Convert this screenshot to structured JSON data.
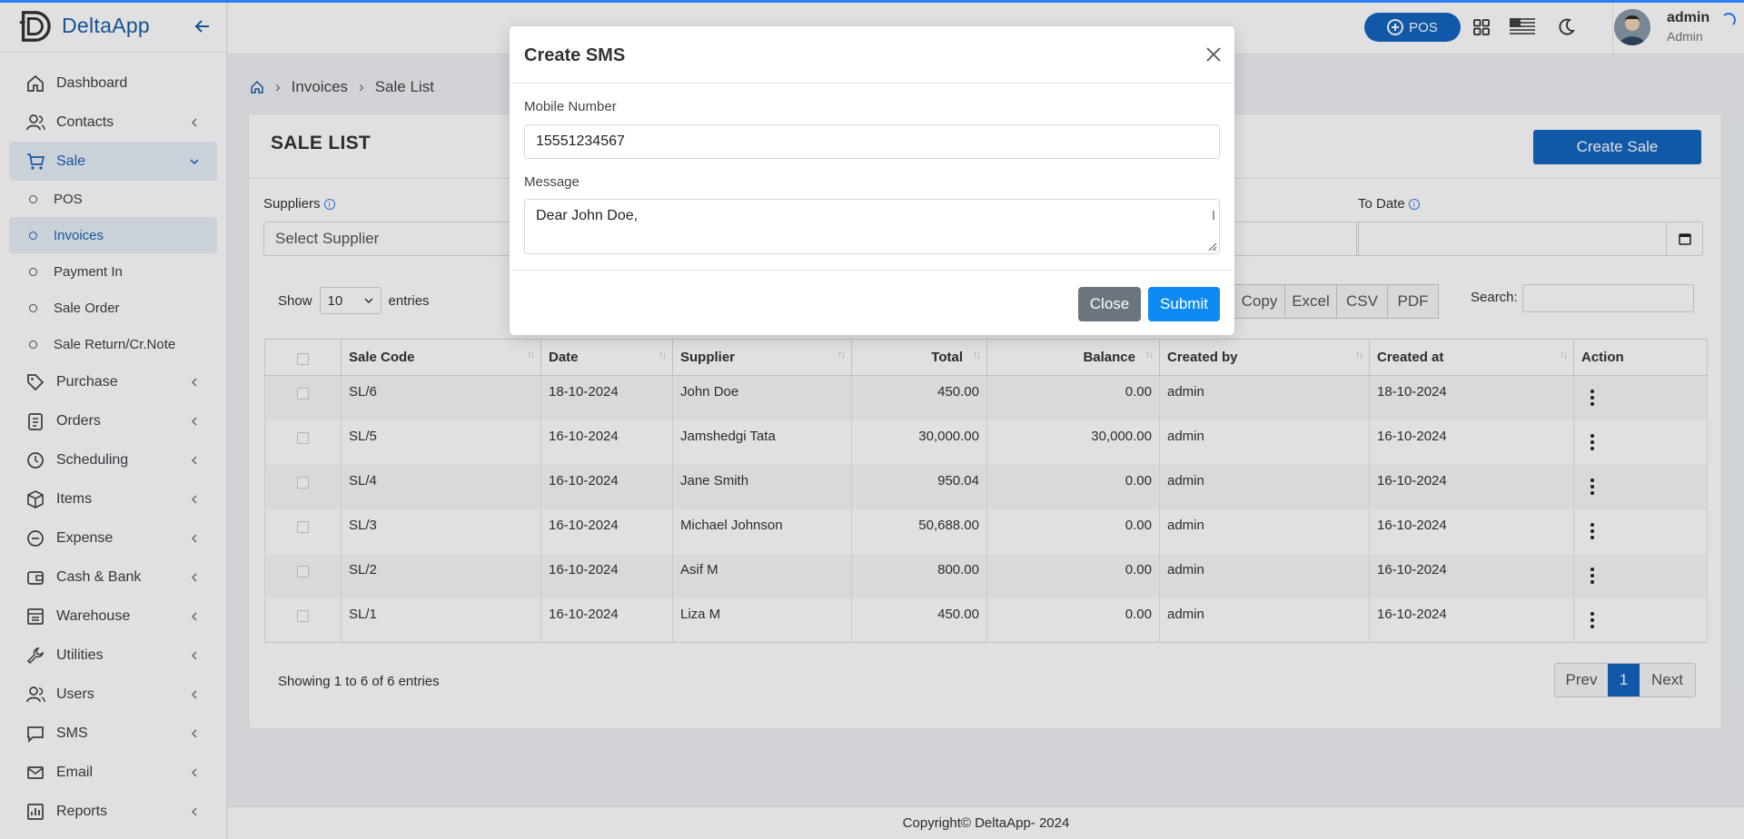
{
  "app": {
    "name": "DeltaApp"
  },
  "sidebar": {
    "items": [
      {
        "label": "Dashboard",
        "icon": "home-icon"
      },
      {
        "label": "Contacts",
        "icon": "users-icon"
      },
      {
        "label": "Sale",
        "icon": "cart-icon"
      },
      {
        "label": "Purchase",
        "icon": "tag-icon"
      },
      {
        "label": "Orders",
        "icon": "clipboard-icon"
      },
      {
        "label": "Scheduling",
        "icon": "calendar-clock-icon"
      },
      {
        "label": "Items",
        "icon": "box-icon"
      },
      {
        "label": "Expense",
        "icon": "minus-circle-icon"
      },
      {
        "label": "Cash & Bank",
        "icon": "wallet-icon"
      },
      {
        "label": "Warehouse",
        "icon": "warehouse-icon"
      },
      {
        "label": "Utilities",
        "icon": "wrench-icon"
      },
      {
        "label": "Users",
        "icon": "users-icon"
      },
      {
        "label": "SMS",
        "icon": "chat-icon"
      },
      {
        "label": "Email",
        "icon": "mail-icon"
      },
      {
        "label": "Reports",
        "icon": "chart-icon"
      }
    ],
    "sale_sub": [
      "POS",
      "Invoices",
      "Payment In",
      "Sale Order",
      "Sale Return/Cr.Note"
    ]
  },
  "topbar": {
    "pos_label": "POS",
    "user_name": "admin",
    "user_role": "Admin"
  },
  "breadcrumb": {
    "level1": "Invoices",
    "level2": "Sale List"
  },
  "page": {
    "title": "SALE LIST",
    "create_button": "Create Sale",
    "suppliers_label": "Suppliers",
    "supplier_placeholder": "Select Supplier",
    "to_date_label": "To Date",
    "show_label": "Show",
    "entries_value": "10",
    "entries_label": "entries",
    "export": [
      "Copy",
      "Excel",
      "CSV",
      "PDF"
    ],
    "search_label": "Search:"
  },
  "table": {
    "headers": [
      "Sale Code",
      "Date",
      "Supplier",
      "Total",
      "Balance",
      "Created by",
      "Created at",
      "Action"
    ],
    "rows": [
      [
        "SL/6",
        "18-10-2024",
        "John Doe",
        "450.00",
        "0.00",
        "admin",
        "18-10-2024"
      ],
      [
        "SL/5",
        "16-10-2024",
        "Jamshedgi Tata",
        "30,000.00",
        "30,000.00",
        "admin",
        "16-10-2024"
      ],
      [
        "SL/4",
        "16-10-2024",
        "Jane Smith",
        "950.04",
        "0.00",
        "admin",
        "16-10-2024"
      ],
      [
        "SL/3",
        "16-10-2024",
        "Michael Johnson",
        "50,688.00",
        "0.00",
        "admin",
        "16-10-2024"
      ],
      [
        "SL/2",
        "16-10-2024",
        "Asif M",
        "800.00",
        "0.00",
        "admin",
        "16-10-2024"
      ],
      [
        "SL/1",
        "16-10-2024",
        "Liza M",
        "450.00",
        "0.00",
        "admin",
        "16-10-2024"
      ]
    ]
  },
  "pagination": {
    "info": "Showing 1 to 6 of 6 entries",
    "prev": "Prev",
    "current": "1",
    "next": "Next"
  },
  "footer": {
    "text": "Copyright© DeltaApp- 2024"
  },
  "modal": {
    "title": "Create SMS",
    "mobile_label": "Mobile Number",
    "mobile_value": "15551234567",
    "message_label": "Message",
    "message_value": "Dear John Doe,",
    "close_label": "Close",
    "submit_label": "Submit"
  },
  "colors": {
    "primary": "#1565c0",
    "submit": "#0d8bf2",
    "close": "#6c757d"
  }
}
